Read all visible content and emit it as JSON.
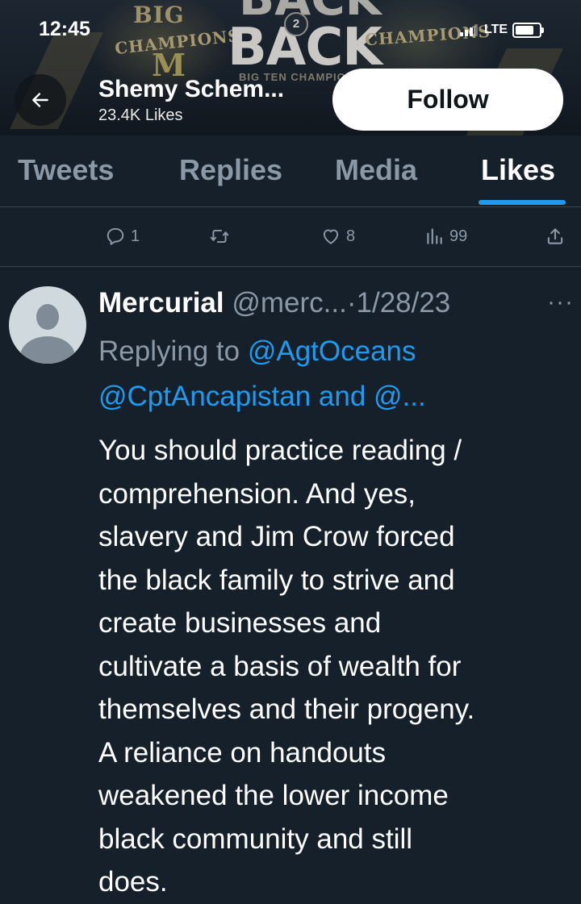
{
  "status_bar": {
    "time": "12:45",
    "network": "LTE"
  },
  "banner_art": {
    "big": "BIG",
    "champions_left": "CHAMPIONS",
    "m_letter": "M",
    "back_top": "BACK",
    "back_number": "2",
    "back_main": "BACK",
    "champions_right": "CHAMPIONS",
    "ten": "BIG TEN CHAMPIONS"
  },
  "profile": {
    "name": "Shemy Schem...",
    "likes_count": "23.4K Likes",
    "follow_label": "Follow"
  },
  "tabs": [
    {
      "label": "Tweets",
      "active": false
    },
    {
      "label": "Replies",
      "active": false
    },
    {
      "label": "Media",
      "active": false
    },
    {
      "label": "Likes",
      "active": true
    }
  ],
  "prev_tweet_actions": {
    "replies": "1",
    "retweets": "",
    "likes": "8",
    "views": "99"
  },
  "tweet": {
    "author_name": "Mercurial",
    "author_handle": "@merc...",
    "separator": "·",
    "date": "1/28/23",
    "more": "···",
    "replying_prefix": "Replying to ",
    "replying_first": "@AgtOceans",
    "replying_rest": "@CptAncapistan and @...",
    "text_lines": [
      "You should practice reading /",
      "comprehension. And yes,",
      "slavery and Jim Crow forced",
      "the black family to strive and",
      "create businesses and",
      "cultivate a basis of wealth for",
      "themselves and their progeny.",
      "A reliance on handouts",
      "weakened the lower income",
      "black community and still",
      "does."
    ]
  },
  "colors": {
    "background": "#15202b",
    "accent": "#1d9bf0",
    "secondary_text": "#8b98a5",
    "divider": "#38444d"
  }
}
